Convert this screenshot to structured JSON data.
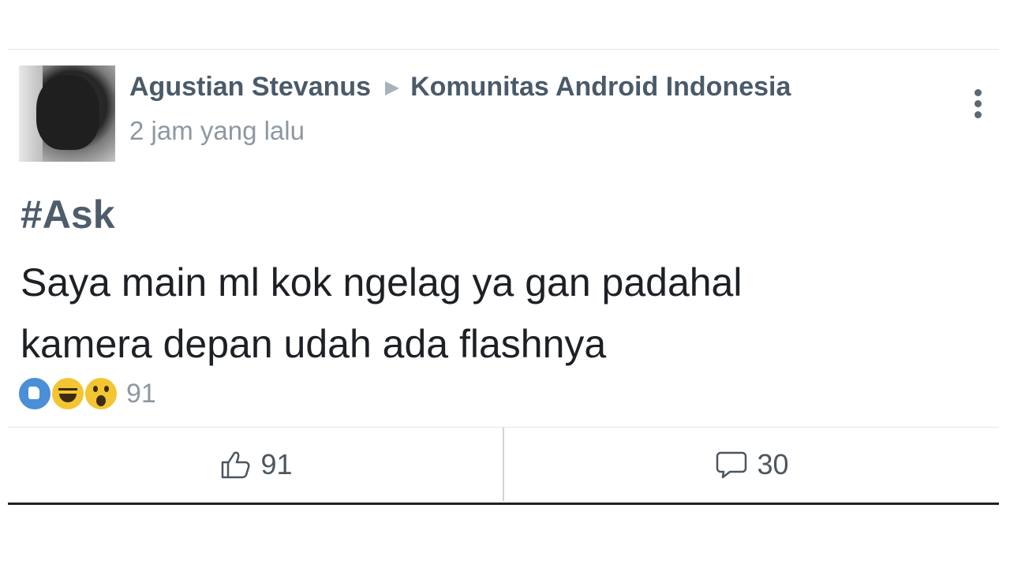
{
  "post": {
    "author": "Agustian Stevanus",
    "group": "Komunitas Android Indonesia",
    "timestamp": "2 jam yang lalu",
    "hashtag": "#Ask",
    "body_line1": "Saya main ml kok ngelag ya gan padahal",
    "body_line2": "kamera depan udah ada flashnya"
  },
  "reactions": {
    "icons": [
      "like-reaction-icon",
      "haha-reaction-icon",
      "wow-reaction-icon"
    ],
    "count": "91"
  },
  "actions": {
    "like_count": "91",
    "comment_count": "30"
  },
  "colors": {
    "author": "#4a5a69",
    "timestamp": "#8e98a2",
    "like_reaction": "#4a8fd7",
    "emoji_reaction": "#f4c533"
  }
}
